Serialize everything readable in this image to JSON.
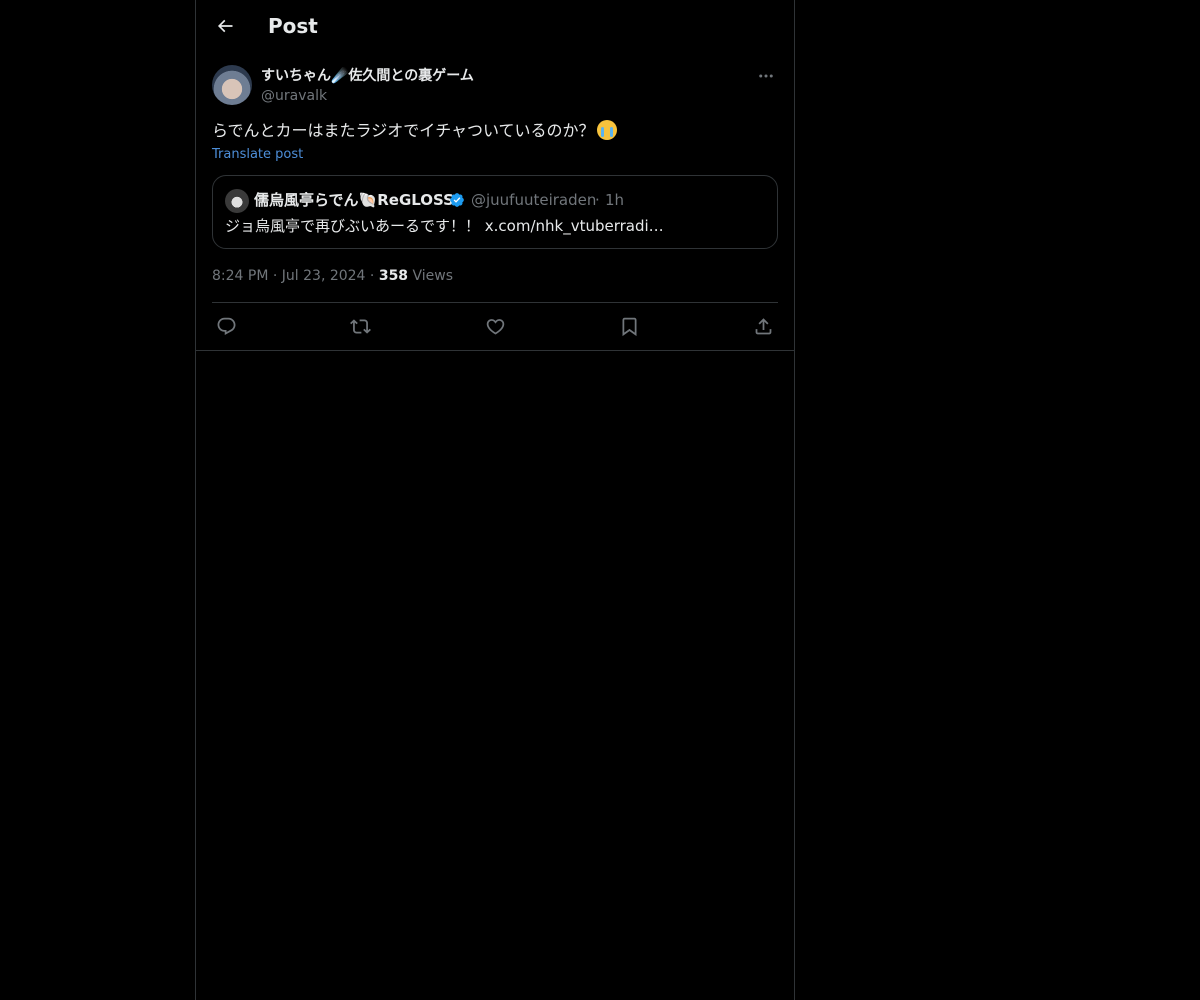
{
  "header": {
    "title": "Post"
  },
  "post": {
    "author_name": "すいちゃん☄️佐久間との裏ゲーム",
    "author_handle": "@uravalk",
    "text": "らでんとカーはまたラジオでイチャついているのか？",
    "translate_label": "Translate post",
    "quote": {
      "author_name": "儒烏風亭らでん🐚ReGLOSS",
      "author_handle": "@juufuuteiraden",
      "separator": "·",
      "time": "1h",
      "text": "ジョ烏風亭で再びぶいあーるです！！ x.com/nhk_vtuberradi…"
    },
    "meta": {
      "time": "8:24 PM",
      "date": "Jul 23, 2024",
      "views_count": "358",
      "views_label": "Views"
    }
  },
  "icons": {
    "back": "arrow-left-icon",
    "more": "more-horizontal-icon",
    "reply": "reply-icon",
    "repost": "repost-icon",
    "like": "heart-icon",
    "bookmark": "bookmark-icon",
    "share": "share-icon",
    "verified": "verified-badge-icon"
  },
  "colors": {
    "background": "#000000",
    "text": "#e7e9ea",
    "secondary": "#71767b",
    "link": "#4d8ed8",
    "verified": "#1d9bf0",
    "border": "#2f3336"
  }
}
